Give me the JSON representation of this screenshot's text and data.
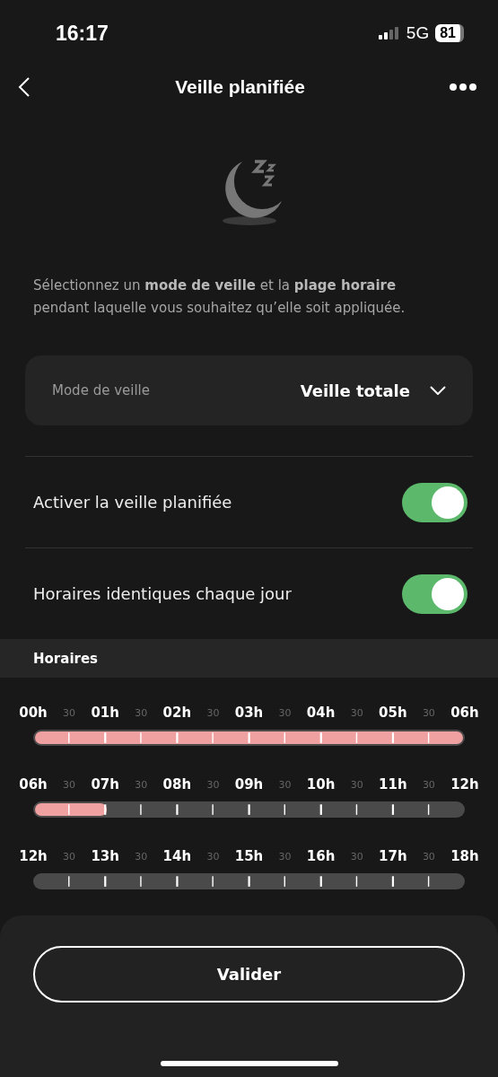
{
  "status_bar": {
    "time": "16:17",
    "network": "5G",
    "battery": "81"
  },
  "header": {
    "title": "Veille planifiée"
  },
  "intro": "Sélectionnez un **mode de veille** et la  **plage horaire** pendant laquelle vous souhaitez qu’elle soit appliquée.",
  "mode": {
    "label": "Mode de veille",
    "value": "Veille totale"
  },
  "settings": [
    {
      "label": "Activer la veille planifiée",
      "on": true
    },
    {
      "label": "Horaires identiques chaque jour",
      "on": true
    }
  ],
  "schedule": {
    "title": "Horaires",
    "rows": [
      {
        "labels": [
          "00h",
          "30",
          "01h",
          "30",
          "02h",
          "30",
          "03h",
          "30",
          "04h",
          "30",
          "05h",
          "30",
          "06h"
        ],
        "level": 1
      },
      {
        "labels": [
          "06h",
          "30",
          "07h",
          "30",
          "08h",
          "30",
          "09h",
          "30",
          "10h",
          "30",
          "11h",
          "30",
          "12h"
        ],
        "level": 0.1667
      },
      {
        "labels": [
          "12h",
          "30",
          "13h",
          "30",
          "14h",
          "30",
          "15h",
          "30",
          "16h",
          "30",
          "17h",
          "30",
          "18h"
        ],
        "level": 0
      }
    ]
  },
  "footer": {
    "button": "Valider"
  }
}
